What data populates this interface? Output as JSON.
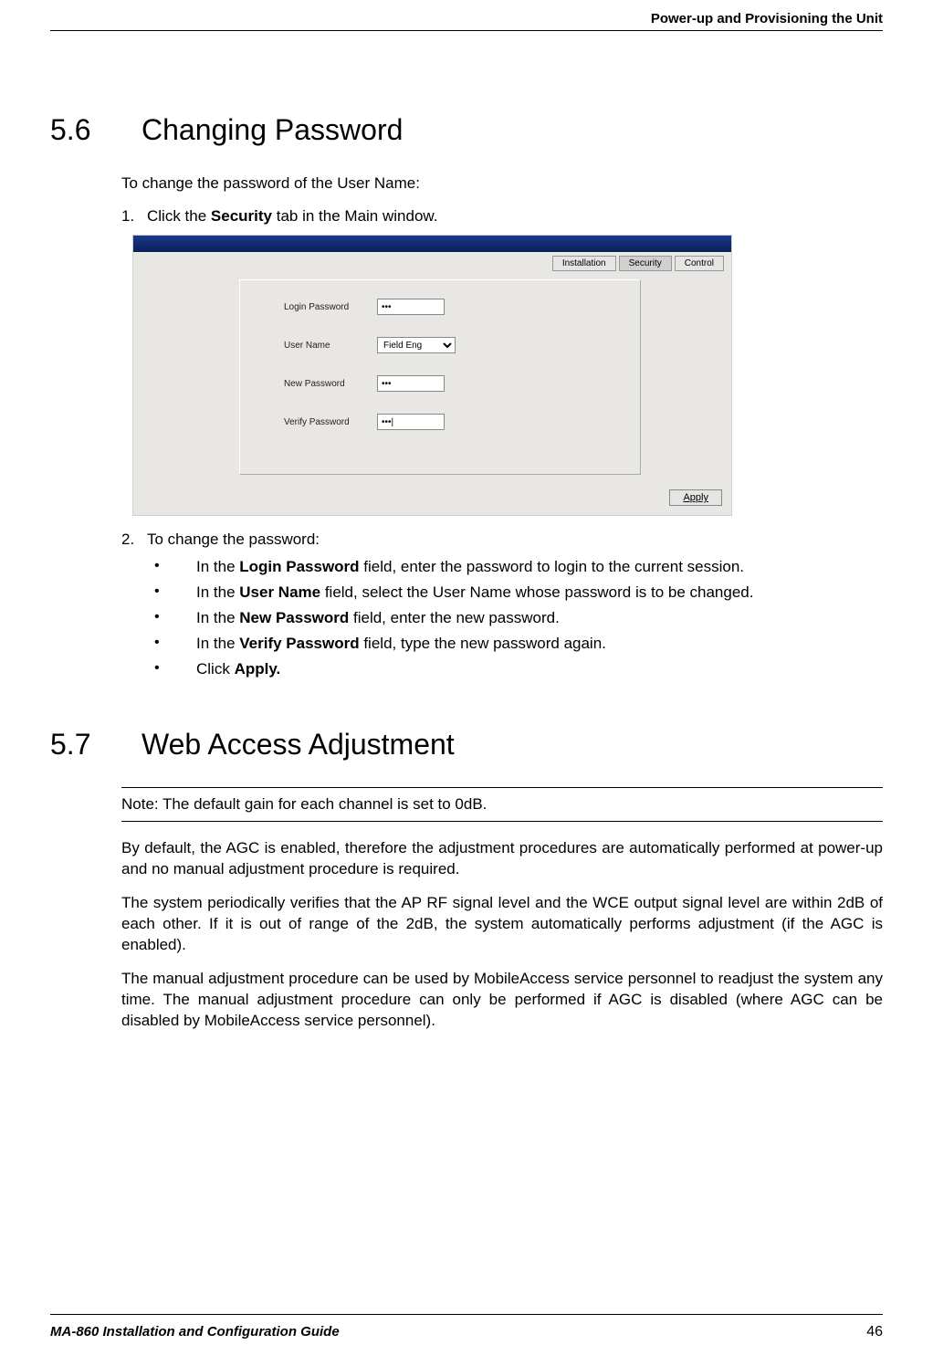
{
  "header": {
    "title": "Power-up and Provisioning the Unit"
  },
  "section_56": {
    "number": "5.6",
    "title": "Changing Password",
    "intro": "To change the password of the User Name:",
    "step1_num": "1.",
    "step1_prefix": "Click the ",
    "step1_bold": "Security",
    "step1_suffix": " tab in the Main window.",
    "step2_num": "2.",
    "step2_text": "To change the password:",
    "bullets": [
      {
        "prefix": "In the ",
        "bold": "Login Password",
        "suffix": " field, enter the password to login to the current session."
      },
      {
        "prefix": "In the ",
        "bold": "User Name",
        "suffix": " field, select the User Name whose password is to be changed."
      },
      {
        "prefix": "In the ",
        "bold": "New Password",
        "suffix": " field, enter the new password."
      },
      {
        "prefix": "In the ",
        "bold": "Verify Password",
        "suffix": " field, type the new password again."
      },
      {
        "prefix": "Click ",
        "bold": "Apply.",
        "suffix": ""
      }
    ]
  },
  "screenshot": {
    "tabs": {
      "installation": "Installation",
      "security": "Security",
      "control": "Control"
    },
    "labels": {
      "login_password": "Login Password",
      "user_name": "User Name",
      "new_password": "New Password",
      "verify_password": "Verify Password"
    },
    "values": {
      "login_password": "•••",
      "user_name": "Field Eng",
      "new_password": "•••",
      "verify_password": "•••|"
    },
    "apply_label": "Apply"
  },
  "section_57": {
    "number": "5.7",
    "title": "Web Access Adjustment",
    "note": "Note: The default gain for each channel is set to 0dB.",
    "para1": "By default, the AGC is enabled, therefore the adjustment procedures are automatically performed at power-up and no manual adjustment procedure is required.",
    "para2": "The system periodically verifies that the AP RF signal level and the WCE output signal level are within 2dB of each other. If it is out of range of the 2dB, the system automatically performs adjustment (if the AGC is enabled).",
    "para3": "The manual adjustment procedure can be used by MobileAccess service personnel to readjust the system any time. The manual adjustment procedure can only be performed if AGC is disabled (where AGC can be disabled by MobileAccess service personnel)."
  },
  "footer": {
    "left": "MA-860 Installation and Configuration Guide",
    "right": "46"
  }
}
